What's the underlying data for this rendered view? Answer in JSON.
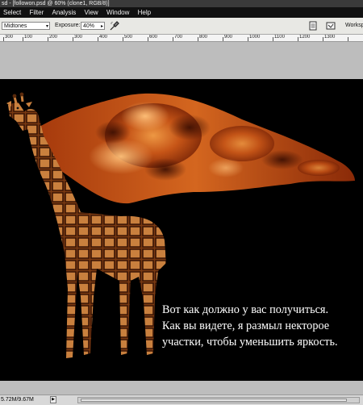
{
  "window": {
    "title": "sd - [followon.psd @ 60% (clone1, RGB/8)]"
  },
  "menu": {
    "items": [
      "Select",
      "Filter",
      "Analysis",
      "View",
      "Window",
      "Help"
    ]
  },
  "options": {
    "range_value": "Midtones",
    "exposure_label": "Exposure:",
    "exposure_value": "40%",
    "workspace_label": "Worksp"
  },
  "ruler": {
    "ticks": [
      "300",
      "100",
      "200",
      "300",
      "400",
      "500",
      "600",
      "700",
      "800",
      "900",
      "1000",
      "1100",
      "1200",
      "1300"
    ]
  },
  "caption": {
    "lines": [
      "Вот как должно у вас получиться.",
      "Как вы видете, я размыл некторое",
      "участки, чтобы уменьшить яркость."
    ]
  },
  "status": {
    "doc_size": "5.72M/9.67M"
  },
  "colors": {
    "menu_bg": "#111111",
    "canvas_bg": "#000000",
    "pasteboard": "#bdbdbd",
    "options_bg": "#e8e8e4"
  },
  "icons": [
    "brush-preset-icon",
    "airbrush-icon",
    "file-browser-icon",
    "palette-well-icon"
  ]
}
